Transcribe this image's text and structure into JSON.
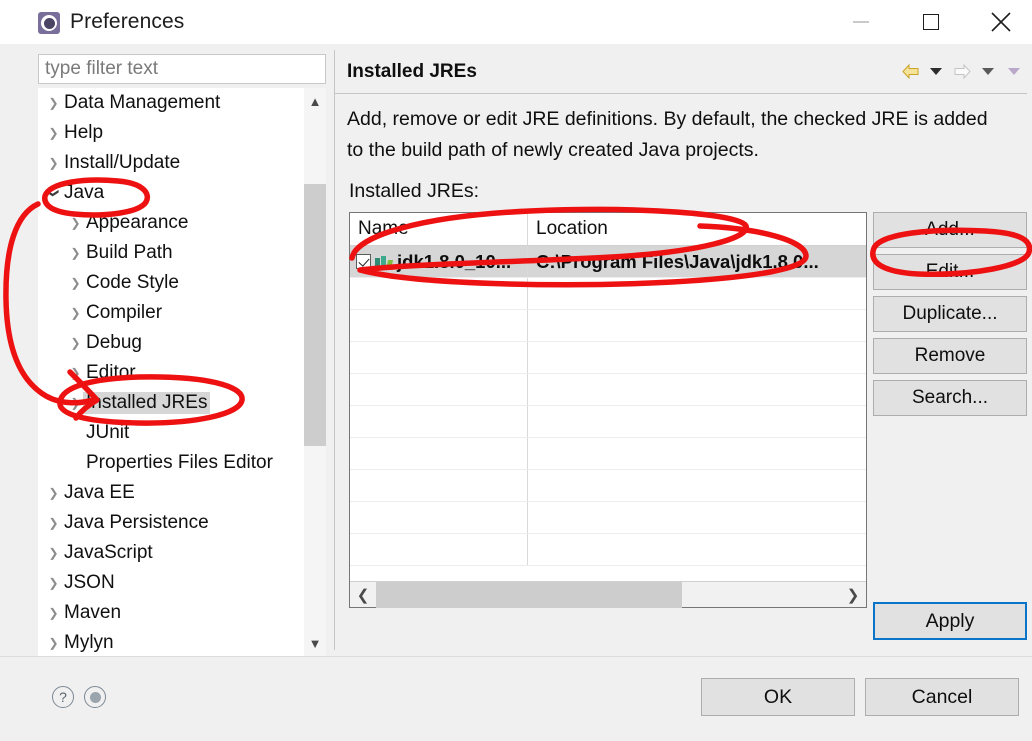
{
  "window": {
    "title": "Preferences",
    "app_icon": "preferences-gear-icon",
    "controls": {
      "minimize": "minimize-icon",
      "maximize": "maximize-icon",
      "close": "close-icon"
    }
  },
  "sidebar": {
    "filter": {
      "placeholder": "type filter text",
      "value": ""
    },
    "items": [
      {
        "label": "Data Management",
        "depth": 0,
        "arrow": "collapsed",
        "selected": false
      },
      {
        "label": "Help",
        "depth": 0,
        "arrow": "collapsed",
        "selected": false
      },
      {
        "label": "Install/Update",
        "depth": 0,
        "arrow": "collapsed",
        "selected": false
      },
      {
        "label": "Java",
        "depth": 0,
        "arrow": "expanded",
        "selected": false
      },
      {
        "label": "Appearance",
        "depth": 1,
        "arrow": "collapsed",
        "selected": false
      },
      {
        "label": "Build Path",
        "depth": 1,
        "arrow": "collapsed",
        "selected": false
      },
      {
        "label": "Code Style",
        "depth": 1,
        "arrow": "collapsed",
        "selected": false
      },
      {
        "label": "Compiler",
        "depth": 1,
        "arrow": "collapsed",
        "selected": false
      },
      {
        "label": "Debug",
        "depth": 1,
        "arrow": "collapsed",
        "selected": false
      },
      {
        "label": "Editor",
        "depth": 1,
        "arrow": "collapsed",
        "selected": false
      },
      {
        "label": "Installed JREs",
        "depth": 1,
        "arrow": "collapsed",
        "selected": true
      },
      {
        "label": "JUnit",
        "depth": 1,
        "arrow": "none",
        "selected": false
      },
      {
        "label": "Properties Files Editor",
        "depth": 1,
        "arrow": "none",
        "selected": false
      },
      {
        "label": "Java EE",
        "depth": 0,
        "arrow": "collapsed",
        "selected": false
      },
      {
        "label": "Java Persistence",
        "depth": 0,
        "arrow": "collapsed",
        "selected": false
      },
      {
        "label": "JavaScript",
        "depth": 0,
        "arrow": "collapsed",
        "selected": false
      },
      {
        "label": "JSON",
        "depth": 0,
        "arrow": "collapsed",
        "selected": false
      },
      {
        "label": "Maven",
        "depth": 0,
        "arrow": "collapsed",
        "selected": false
      },
      {
        "label": "Mylyn",
        "depth": 0,
        "arrow": "collapsed",
        "selected": false
      }
    ],
    "scrollbar": {
      "up": "chevron-up-icon",
      "down": "chevron-down-icon"
    }
  },
  "pane": {
    "title": "Installed JREs",
    "description": "Add, remove or edit JRE definitions. By default, the checked JRE is added to the build path of newly created Java projects.",
    "list_label": "Installed JREs:",
    "nav": {
      "back": "back-arrow-icon",
      "back_menu": "caret-down-icon",
      "forward": "forward-arrow-icon",
      "forward_menu": "caret-down-icon",
      "overflow_menu": "caret-down-icon"
    }
  },
  "table": {
    "columns": [
      "Name",
      "Location"
    ],
    "rows": [
      {
        "checked": true,
        "icon": "jre-library-icon",
        "name": "jdk1.8.0_10...",
        "location": "C:\\Program Files\\Java\\jdk1.8.0...",
        "selected": true
      }
    ],
    "empty_row_count": 9,
    "hscroll": {
      "left": "chevron-left-icon",
      "right": "chevron-right-icon",
      "thumb_percent": 66
    }
  },
  "buttons": {
    "side": [
      "Add...",
      "Edit...",
      "Duplicate...",
      "Remove",
      "Search..."
    ],
    "apply": "Apply",
    "ok": "OK",
    "cancel": "Cancel"
  },
  "footer": {
    "help_icon": "question-mark-icon",
    "menu_icon": "filled-circle-icon"
  },
  "annotations": {
    "color": "#ee1111",
    "marks": [
      "circle-around-java-tree-item",
      "arrow-from-java-to-installed-jres",
      "circle-around-installed-jres-tree-item",
      "oval-around-selected-jre-table-row",
      "oval-around-edit-button"
    ]
  },
  "colors": {
    "accent_focus": "#0a74c8",
    "selection": "#d6d6d6",
    "dialog_bg": "#f0f0f0",
    "annotation_red": "#ee1111"
  }
}
